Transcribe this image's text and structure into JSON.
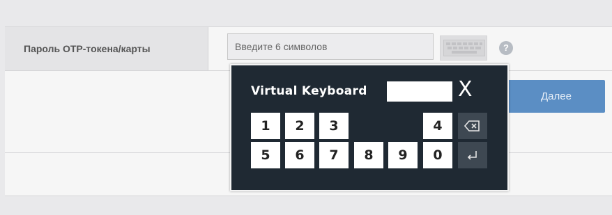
{
  "form": {
    "otp_label": "Пароль OTP-токена/карты",
    "otp_placeholder": "Введите 6 символов",
    "help_symbol": "?",
    "next_label": "Далее"
  },
  "virtual_keyboard": {
    "title": "Virtual Keyboard",
    "close_symbol": "X",
    "display_value": "",
    "row1": [
      "1",
      "2",
      "3",
      "4"
    ],
    "row2": [
      "5",
      "6",
      "7",
      "8",
      "9",
      "0"
    ],
    "backspace_icon": "backspace-icon",
    "enter_icon": "enter-icon"
  }
}
